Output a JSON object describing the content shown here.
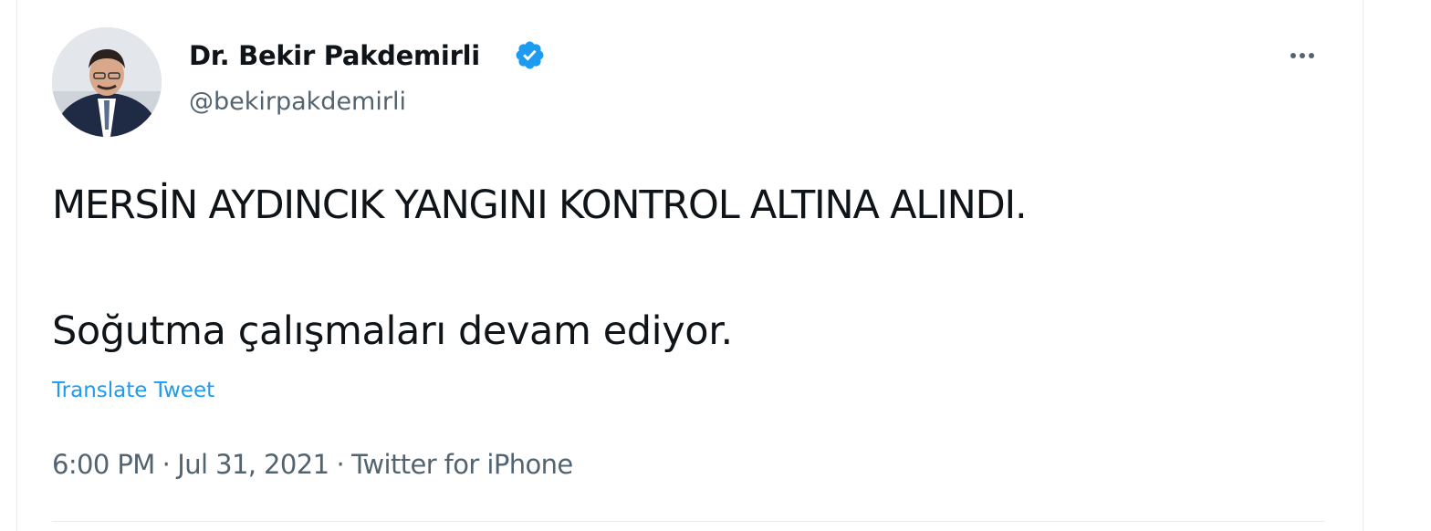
{
  "tweet": {
    "author": {
      "display_name": "Dr. Bekir Pakdemirli",
      "handle": "@bekirpakdemirli",
      "verified": true,
      "avatar_icon": "profile-photo"
    },
    "more_icon": "ellipsis-icon",
    "text_line_1": "MERSİN AYDINCIK YANGINI KONTROL ALTINA ALINDI.",
    "text_line_2": "Soğutma çalışmaları devam ediyor.",
    "translate_label": "Translate Tweet",
    "time": "6:00 PM",
    "date": "Jul 31, 2021",
    "source": "Twitter for iPhone",
    "separator": "·"
  },
  "colors": {
    "accent": "#1d9bf0",
    "text_primary": "#0f1419",
    "text_secondary": "#536471",
    "border": "#e6ecf0"
  }
}
